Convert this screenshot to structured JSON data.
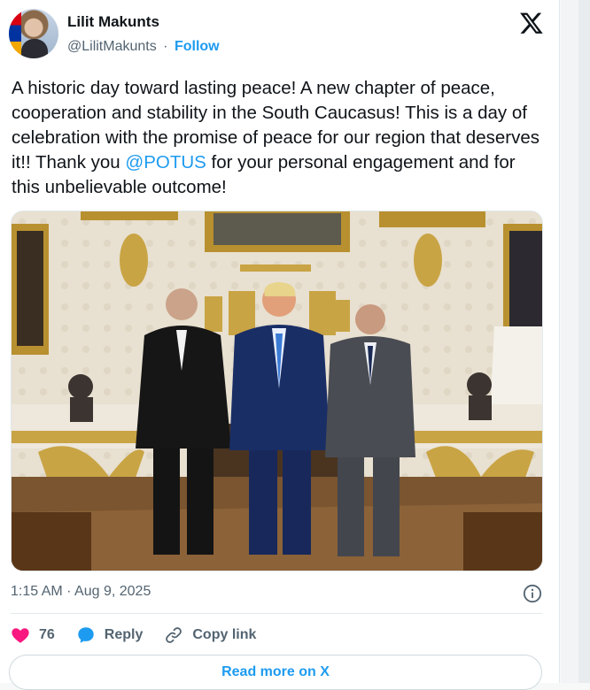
{
  "author": {
    "name": "Lilit Makunts",
    "handle": "@LilitMakunts",
    "separator": "·",
    "follow_label": "Follow"
  },
  "tweet": {
    "text_before_mention": "A historic day toward lasting peace! A new chapter of peace, cooperation and stability in the South Caucasus! This is a day of celebration with the promise of peace for our region that deserves it!! Thank you ",
    "mention": "@POTUS",
    "text_after_mention": " for your personal engagement and for this unbelievable outcome!",
    "timestamp": "1:15 AM · Aug 9, 2025"
  },
  "actions": {
    "like_count": "76",
    "reply_label": "Reply",
    "copy_link_label": "Copy link"
  },
  "read_more_label": "Read more on X",
  "icons": {
    "brand": "x-logo-icon",
    "info": "info-icon",
    "like": "heart-icon",
    "reply": "speech-bubble-icon",
    "copy": "link-icon"
  },
  "colors": {
    "link": "#1d9bf0",
    "like": "#f91880",
    "secondary_text": "#536471"
  }
}
